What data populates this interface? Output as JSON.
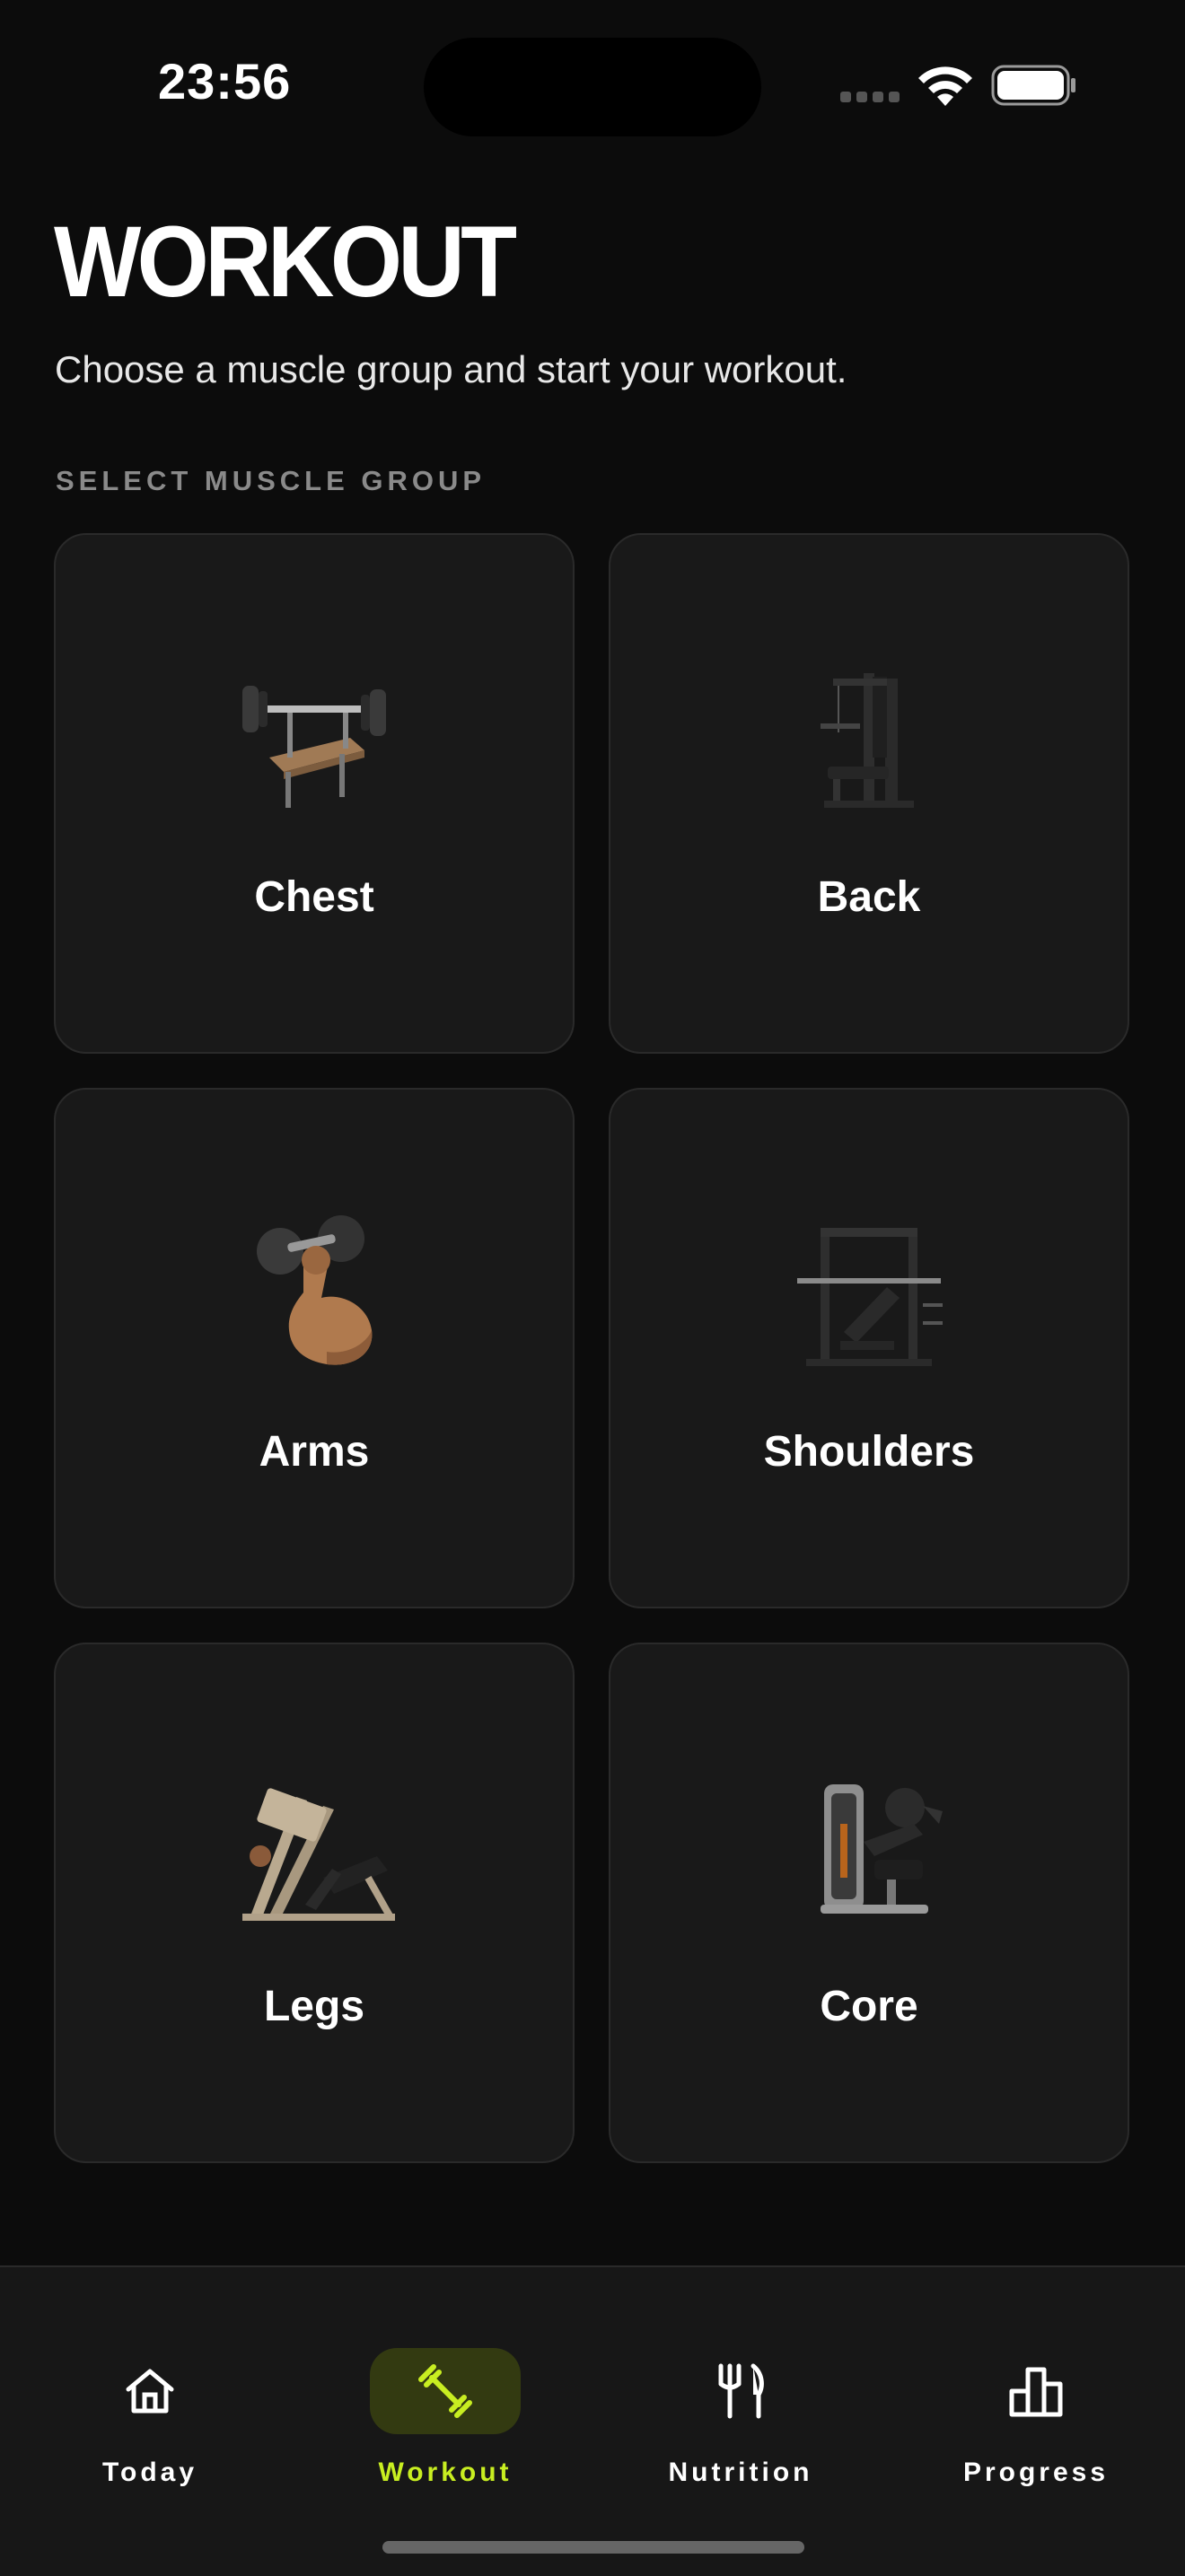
{
  "status_bar": {
    "time": "23:56"
  },
  "header": {
    "title": "WORKOUT",
    "subtitle": "Choose a muscle group and start your workout.",
    "section_label": "SELECT MUSCLE GROUP"
  },
  "muscle_groups": [
    {
      "label": "Chest",
      "icon": "bench-press-icon"
    },
    {
      "label": "Back",
      "icon": "lat-pulldown-machine-icon"
    },
    {
      "label": "Arms",
      "icon": "flexed-arm-dumbbell-icon"
    },
    {
      "label": "Shoulders",
      "icon": "smith-machine-icon"
    },
    {
      "label": "Legs",
      "icon": "leg-press-machine-icon"
    },
    {
      "label": "Core",
      "icon": "ab-crunch-machine-icon"
    }
  ],
  "tabs": [
    {
      "label": "Today",
      "icon": "home-icon"
    },
    {
      "label": "Workout",
      "icon": "dumbbell-icon",
      "active": true
    },
    {
      "label": "Nutrition",
      "icon": "fork-knife-icon"
    },
    {
      "label": "Progress",
      "icon": "podium-chart-icon"
    }
  ],
  "colors": {
    "accent": "#c8ee21",
    "background": "#0c0c0c",
    "card": "#191919"
  }
}
